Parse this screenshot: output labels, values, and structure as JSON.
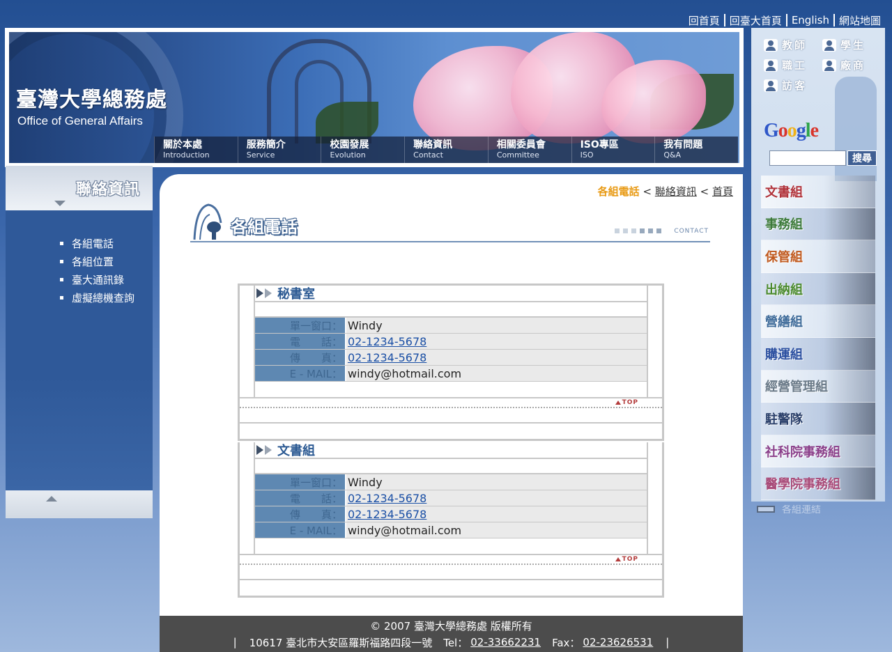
{
  "top_links": [
    "回首頁",
    "回臺大首頁",
    "English",
    "網站地圖"
  ],
  "header": {
    "logo_cn": "臺灣大學總務處",
    "logo_en": "Office of General Affairs",
    "nav": [
      {
        "cn": "關於本處",
        "en": "Introduction"
      },
      {
        "cn": "服務簡介",
        "en": "Service"
      },
      {
        "cn": "校園發展",
        "en": "Evolution"
      },
      {
        "cn": "聯絡資訊",
        "en": "Contact"
      },
      {
        "cn": "相關委員會",
        "en": "Committee"
      },
      {
        "cn": "ISO專區",
        "en": "ISO"
      },
      {
        "cn": "我有問題",
        "en": "Q&A"
      }
    ]
  },
  "user_links": [
    "教師",
    "學生",
    "職工",
    "廠商",
    "訪客"
  ],
  "search": {
    "button": "搜尋",
    "value": ""
  },
  "departments": [
    "文書組",
    "事務組",
    "保管組",
    "出納組",
    "營繕組",
    "購運組",
    "經營管理組",
    "駐警隊",
    "社科院事務組",
    "醫學院事務組"
  ],
  "more_links": "各組連結",
  "sidebar": {
    "title": "聯絡資訊",
    "items": [
      "各組電話",
      "各組位置",
      "臺大通訊錄",
      "虛擬總機查詢"
    ]
  },
  "breadcrumb": {
    "current": "各組電話",
    "sep": "<",
    "parent": "聯絡資訊",
    "home": "首頁"
  },
  "page": {
    "title": "各組電話",
    "subtitle_en": "CONTACT"
  },
  "labels": {
    "window": "單一窗口：",
    "phone": "電　　話：",
    "fax": "傳　　真：",
    "email": "E - MAIL："
  },
  "top_label": "TOP",
  "blocks": [
    {
      "name": "秘書室",
      "window": "Windy",
      "phone": "02-1234-5678",
      "fax": "02-1234-5678",
      "email": "windy@hotmail.com"
    },
    {
      "name": "文書組",
      "window": "Windy",
      "phone": "02-1234-5678",
      "fax": "02-1234-5678",
      "email": "windy@hotmail.com"
    }
  ],
  "footer": {
    "copyright": "© 2007 臺灣大學總務處 版權所有",
    "address": "10617 臺北市大安區羅斯福路四段一號",
    "tel_label": "Tel：",
    "tel": "02-33662231",
    "fax_label": "Fax：",
    "fax": "02-23626531"
  }
}
